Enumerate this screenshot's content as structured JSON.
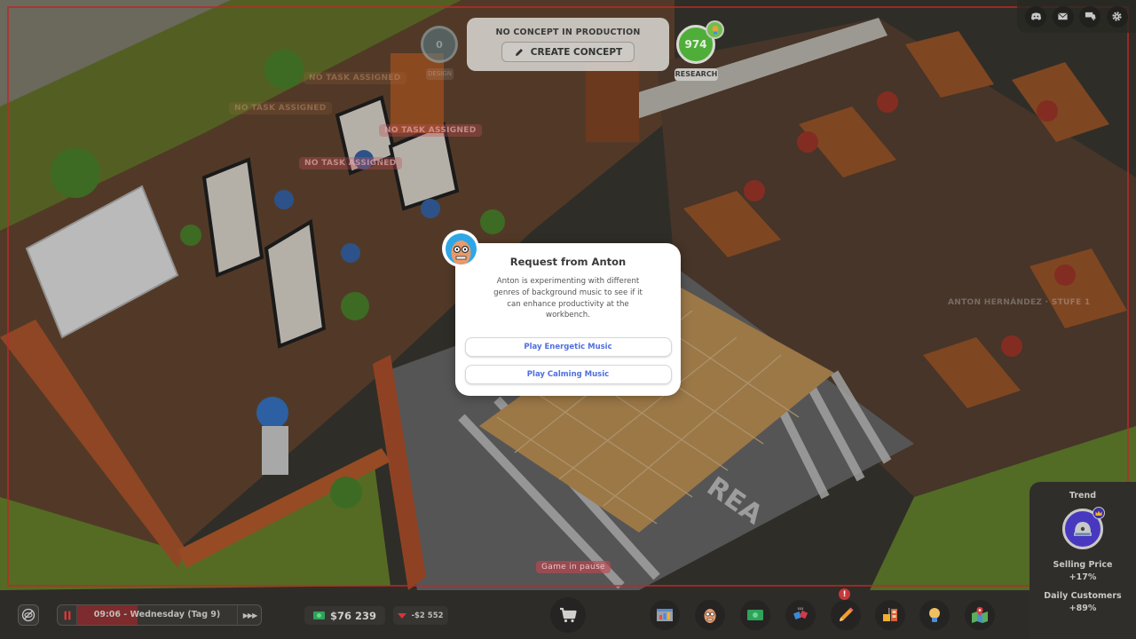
{
  "top_panel": {
    "status": "NO CONCEPT IN PRODUCTION",
    "create_concept_label": "CREATE CONCEPT",
    "design_value": "0",
    "design_label": "DESIGN",
    "research_value": "974",
    "research_label": "RESEARCH"
  },
  "top_right": {
    "icons": [
      "discord-icon",
      "mail-icon",
      "chat-notifications-icon",
      "gear-icon"
    ]
  },
  "world_labels": {
    "no_task": "NO TASK ASSIGNED",
    "employee_tag": "ANTON HERNÁNDEZ · STUFE 1",
    "area_text": "REA",
    "pause_banner": "Game in pause"
  },
  "dialog": {
    "title": "Request from Anton",
    "body": "Anton is experimenting with different genres of background music to see if it can enhance productivity at the workbench.",
    "options": [
      {
        "label": "Play Energetic Music"
      },
      {
        "label": "Play Calming Music"
      }
    ]
  },
  "bottom_bar": {
    "time_text": "09:06 - Wednesday (Tag 9)",
    "day_progress": 0.38,
    "speed_label": "▶▶▶",
    "money": "$76 239",
    "delta": "-$2 552",
    "alert_badge": "!",
    "dock": [
      {
        "name": "shop-icon"
      },
      {
        "name": "stats-icon"
      },
      {
        "name": "employees-icon"
      },
      {
        "name": "finance-icon"
      },
      {
        "name": "marketing-icon"
      },
      {
        "name": "concept-pencil-icon"
      },
      {
        "name": "production-icon"
      },
      {
        "name": "ideas-bulb-icon"
      },
      {
        "name": "map-icon"
      }
    ]
  },
  "trend": {
    "title": "Trend",
    "selling_price_label": "Selling Price",
    "selling_price_value": "+17%",
    "daily_customers_label": "Daily Customers",
    "daily_customers_value": "+89%"
  },
  "colors": {
    "accent_blue": "#4f6fe0",
    "pause_red": "#be2828",
    "research_green": "#4fae3a",
    "trend_purple": "#4838c0"
  }
}
